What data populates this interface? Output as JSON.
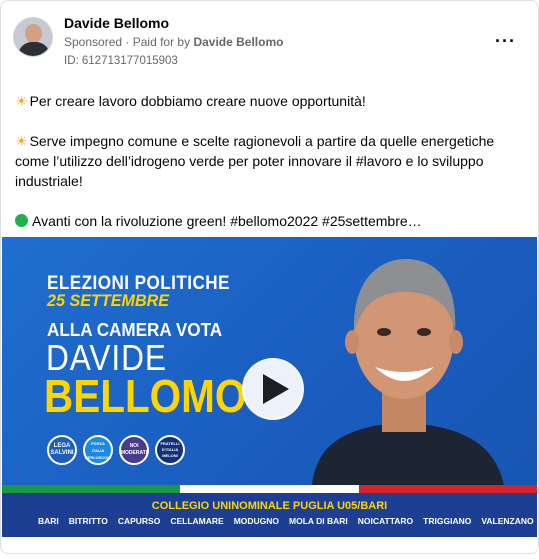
{
  "post": {
    "author": "Davide Bellomo",
    "sponsored": "Sponsored",
    "paid_prefix": "· Paid for by",
    "paid_by": "Davide Bellomo",
    "ad_id": "ID: 612713177015903",
    "more_label": "···",
    "paragraph1": "Per creare lavoro dobbiamo creare nuove opportunità!",
    "paragraph2_line1": "Serve impegno comune e scelte ragionevoli a partire da quelle energetiche",
    "paragraph2_line2": "come l’utilizzo dell’idrogeno verde per poter innovare il #lavoro e lo sviluppo",
    "paragraph2_line3": "industriale!",
    "paragraph3": "Avanti con la rivoluzione green! #bellomo2022 #25settembre…"
  },
  "banner": {
    "line1": "ELEZIONI POLITICHE",
    "line2": "25 SETTEMBRE",
    "line3": "ALLA CAMERA VOTA",
    "first_name": "DAVIDE",
    "last_name": "BELLOMO",
    "logos": [
      {
        "label": "LEGA SALVINI",
        "color": "#1d5fb8"
      },
      {
        "label": "FORZA ITALIA BERLUSCONI",
        "color": "#1e88e5"
      },
      {
        "label": "NOI MODERATI",
        "color": "#4a3b8f"
      },
      {
        "label": "FRATELLI D'ITALIA MELONI",
        "color": "#13307a"
      }
    ],
    "footer_title": "COLLEGIO UNINOMINALE PUGLIA U05/BARI",
    "places": [
      "BARI",
      "BITRITTO",
      "CAPURSO",
      "CELLAMARE",
      "MODUGNO",
      "MOLA DI BARI",
      "NOICATTARO",
      "TRIGGIANO",
      "VALENZANO"
    ],
    "colors": {
      "blue": "#1f6fd0",
      "yellow": "#ffd500",
      "navy": "#1d3f93"
    }
  }
}
